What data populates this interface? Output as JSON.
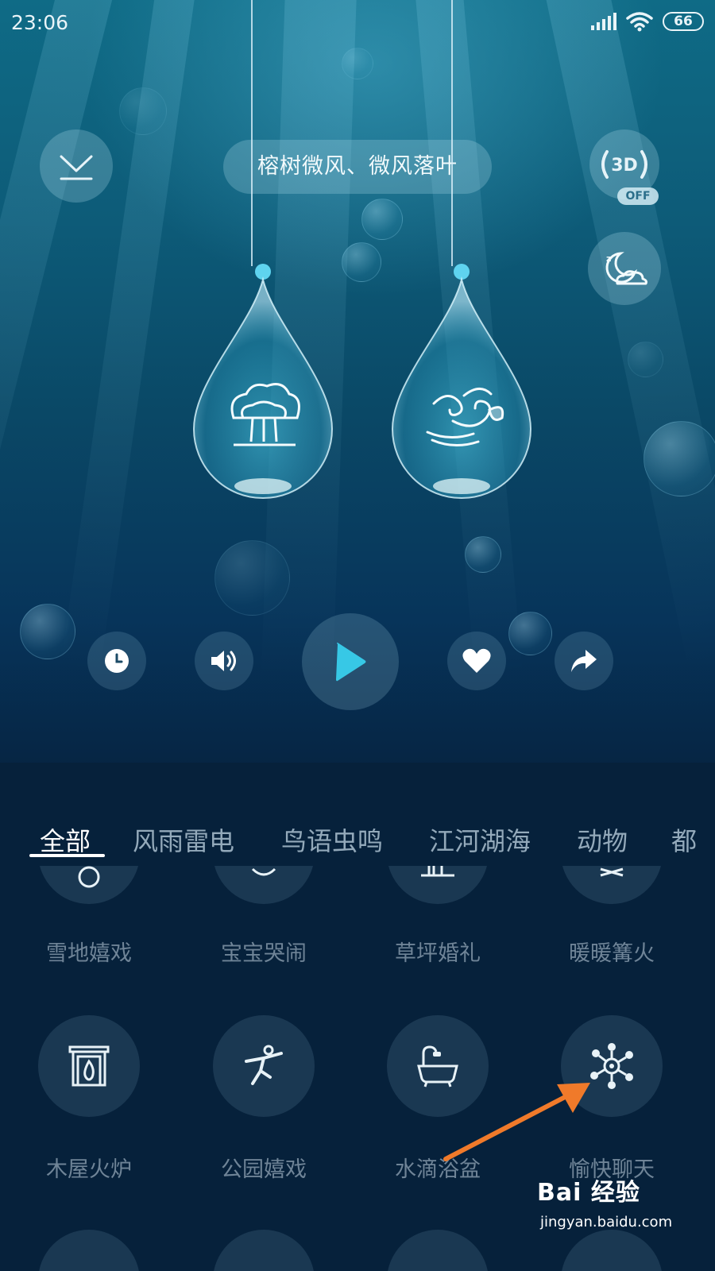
{
  "status_bar": {
    "time": "23:06",
    "battery": "66"
  },
  "header": {
    "title": "榕树微风、微风落叶",
    "mode_3d_label": "3D",
    "mode_3d_state": "OFF"
  },
  "player": {
    "drops": [
      {
        "icon": "banyan-tree-icon"
      },
      {
        "icon": "wind-leaf-icon"
      }
    ],
    "controls": [
      "timer-icon",
      "volume-icon",
      "play-icon",
      "heart-icon",
      "share-icon"
    ]
  },
  "tabs": {
    "items": [
      "全部",
      "风雨雷电",
      "鸟语虫鸣",
      "江河湖海",
      "动物",
      "都"
    ],
    "active": 0
  },
  "sounds": {
    "row1": [
      "雪地嬉戏",
      "宝宝哭闹",
      "草坪婚礼",
      "暖暖篝火"
    ],
    "row2": [
      "木屋火炉",
      "公园嬉戏",
      "水滴浴盆",
      "愉快聊天"
    ]
  },
  "watermark": {
    "brand": "Bai 经验",
    "url": "jingyan.baidu.com"
  },
  "colors": {
    "accent": "#37c8e6",
    "arrow": "#f07a2a"
  }
}
